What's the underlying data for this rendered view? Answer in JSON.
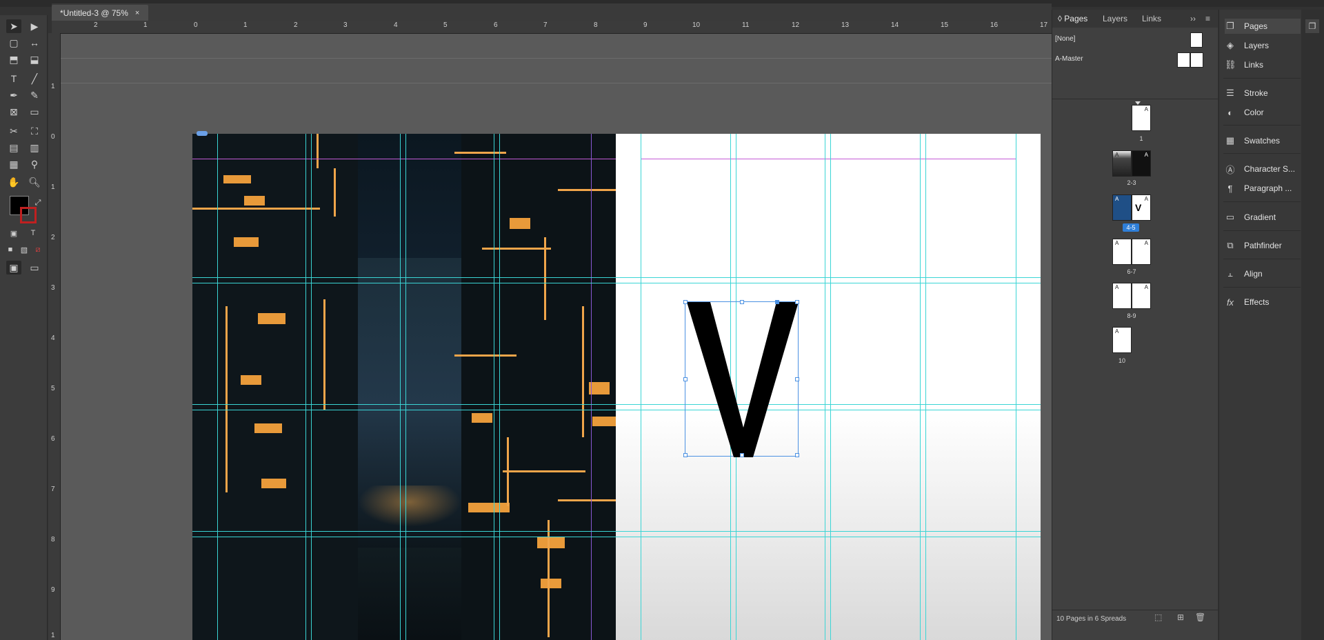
{
  "document": {
    "tab_title": "*Untitled-3 @ 75%",
    "close_glyph": "×"
  },
  "ruler": {
    "top_labels": [
      "2",
      "1",
      "0",
      "1",
      "2",
      "3",
      "4",
      "5",
      "6",
      "7",
      "8",
      "9",
      "10",
      "11",
      "12",
      "13",
      "14",
      "15",
      "16",
      "17"
    ],
    "left_labels": [
      "1",
      "0",
      "1",
      "2",
      "3",
      "4",
      "5",
      "6",
      "7",
      "8",
      "9",
      "1"
    ]
  },
  "canvas": {
    "selected_glyph": "V"
  },
  "pages_panel": {
    "tabs": [
      "Pages",
      "Layers",
      "Links"
    ],
    "masters": [
      "[None]",
      "A-Master"
    ],
    "spreads": [
      {
        "label": "1",
        "prefix": "A"
      },
      {
        "label": "2-3",
        "prefix": "A"
      },
      {
        "label": "4-5",
        "prefix": "A",
        "selected": true
      },
      {
        "label": "6-7",
        "prefix": "A"
      },
      {
        "label": "8-9",
        "prefix": "A"
      },
      {
        "label": "10",
        "prefix": "A"
      }
    ],
    "status": "10 Pages in 6 Spreads"
  },
  "dock": {
    "items": [
      "Pages",
      "Layers",
      "Links",
      "Stroke",
      "Color",
      "Swatches",
      "Character S...",
      "Paragraph ...",
      "Gradient",
      "Pathfinder",
      "Align",
      "Effects"
    ]
  },
  "colors": {
    "guide": "#3ad5d5",
    "margin": "#c35ad6",
    "selection": "#4a90e2",
    "accent_selected_label": "#2f7fd8"
  }
}
